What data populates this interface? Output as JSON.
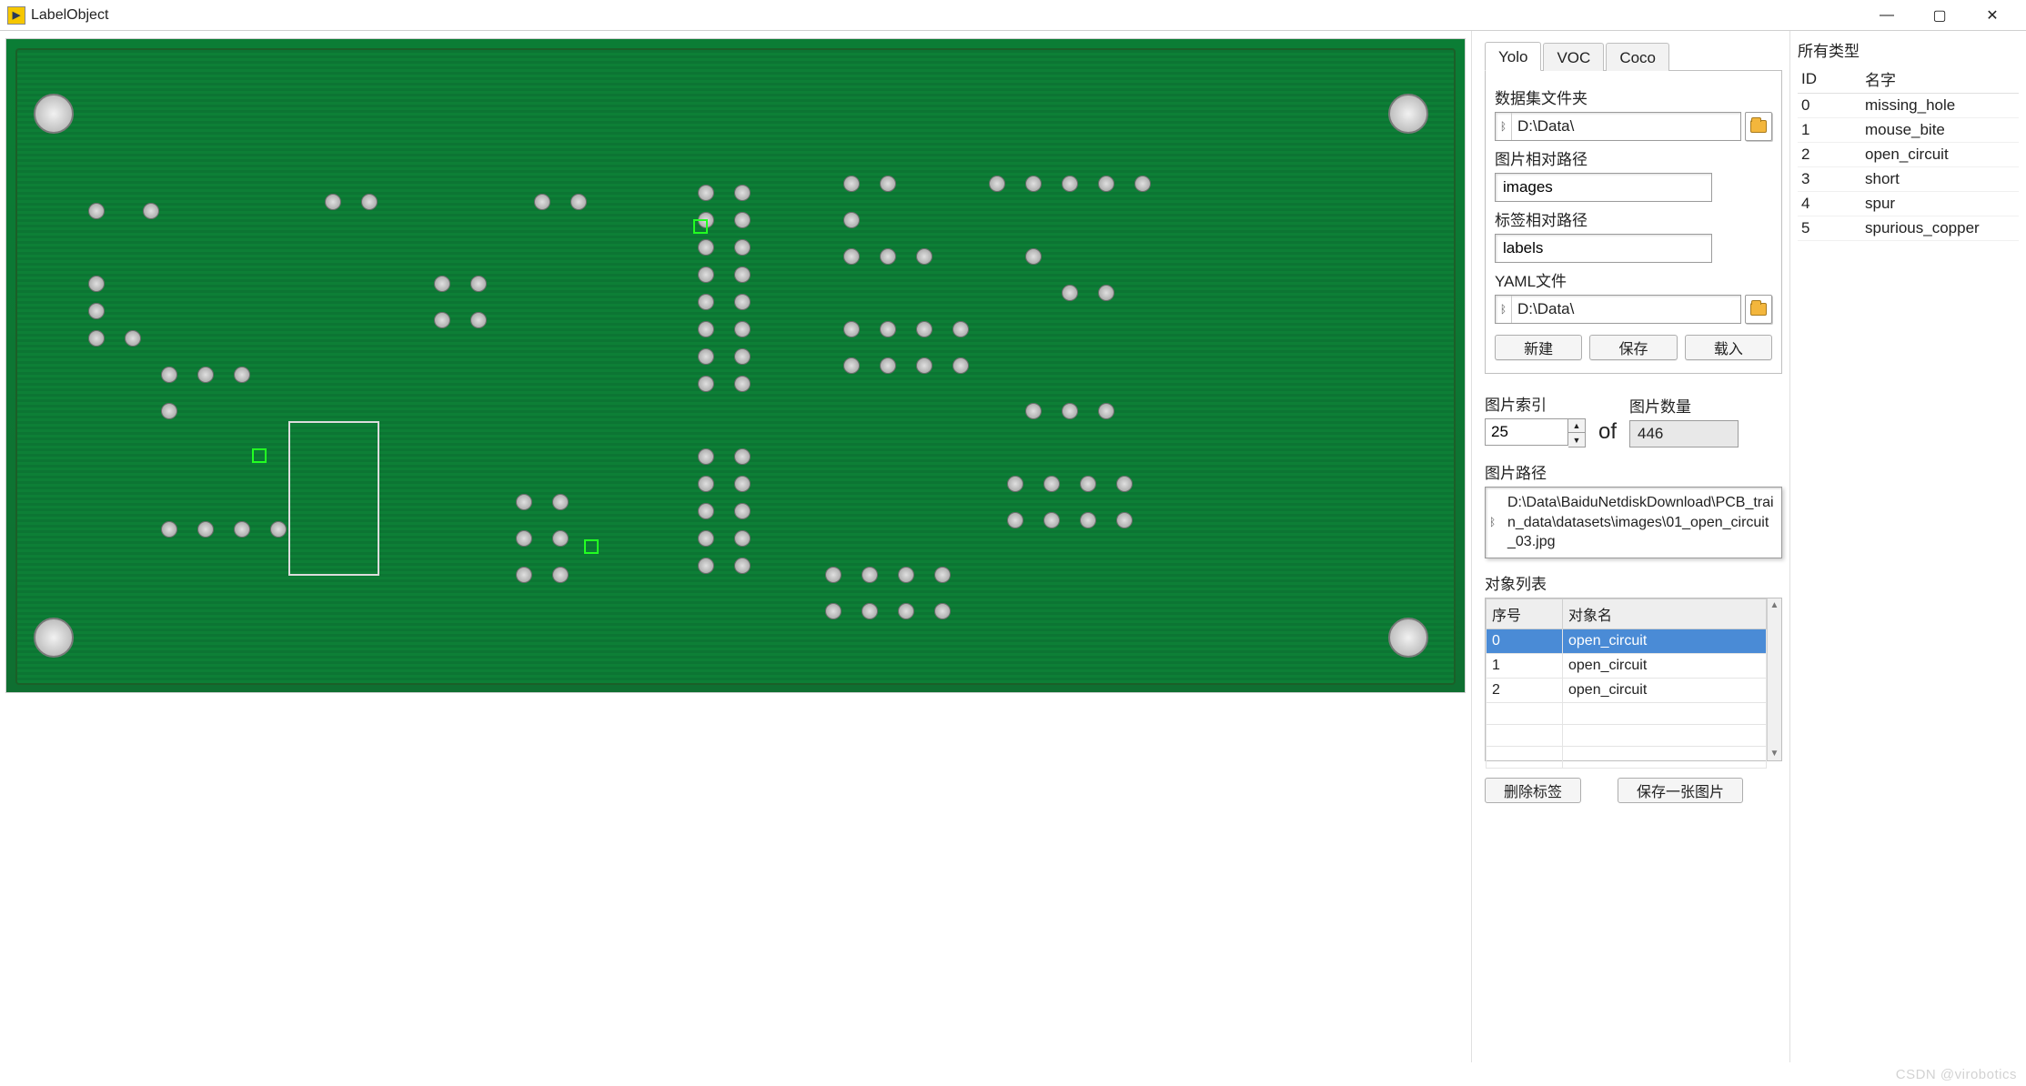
{
  "window": {
    "title": "LabelObject"
  },
  "tabs": [
    {
      "label": "Yolo",
      "active": true
    },
    {
      "label": "VOC",
      "active": false
    },
    {
      "label": "Coco",
      "active": false
    }
  ],
  "fields": {
    "dataset_folder_label": "数据集文件夹",
    "dataset_folder_value": "D:\\Data\\",
    "image_rel_label": "图片相对路径",
    "image_rel_value": "images",
    "label_rel_label": "标签相对路径",
    "label_rel_value": "labels",
    "yaml_label": "YAML文件",
    "yaml_value": "D:\\Data\\"
  },
  "buttons": {
    "new": "新建",
    "save": "保存",
    "load": "载入",
    "delete_label": "删除标签",
    "save_image": "保存一张图片"
  },
  "image_index": {
    "index_label": "图片索引",
    "count_label": "图片数量",
    "current": "25",
    "of": "of",
    "total": "446"
  },
  "image_path": {
    "label": "图片路径",
    "value": "D:\\Data\\BaiduNetdiskDownload\\PCB_train_data\\datasets\\images\\01_open_circuit_03.jpg"
  },
  "object_list": {
    "title": "对象列表",
    "cols": {
      "index": "序号",
      "name": "对象名"
    },
    "rows": [
      {
        "idx": "0",
        "name": "open_circuit",
        "selected": true
      },
      {
        "idx": "1",
        "name": "open_circuit",
        "selected": false
      },
      {
        "idx": "2",
        "name": "open_circuit",
        "selected": false
      }
    ],
    "empty_rows": 3
  },
  "classes": {
    "title": "所有类型",
    "cols": {
      "id": "ID",
      "name": "名字"
    },
    "rows": [
      {
        "id": "0",
        "name": "missing_hole"
      },
      {
        "id": "1",
        "name": "mouse_bite"
      },
      {
        "id": "2",
        "name": "open_circuit"
      },
      {
        "id": "3",
        "name": "short"
      },
      {
        "id": "4",
        "name": "spur"
      },
      {
        "id": "5",
        "name": "spurious_copper"
      }
    ]
  },
  "watermark": "CSDN @virobotics"
}
